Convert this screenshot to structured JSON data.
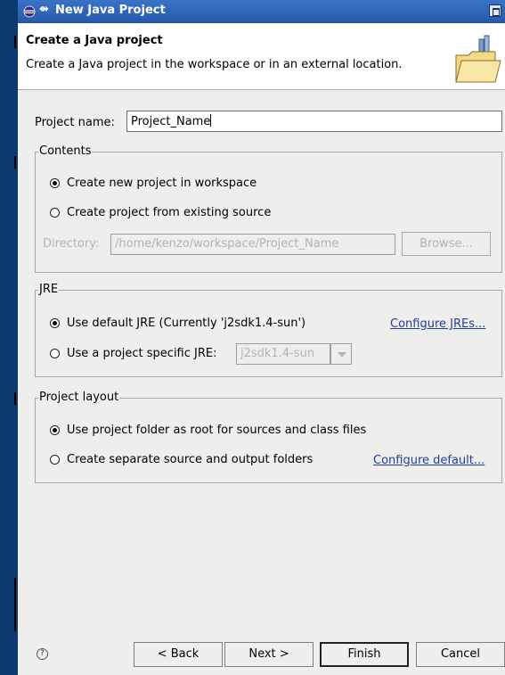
{
  "window": {
    "title": "New Java Project"
  },
  "header": {
    "title": "Create a Java project",
    "description": "Create a Java project in the workspace or in an external location."
  },
  "project_name": {
    "label": "Project name:",
    "value": "Project_Name"
  },
  "contents": {
    "legend": "Contents",
    "options": [
      {
        "label": "Create new project in workspace",
        "checked": true
      },
      {
        "label": "Create project from existing source",
        "checked": false
      }
    ],
    "directory_label": "Directory:",
    "directory_value": "/home/kenzo/workspace/Project_Name",
    "browse_label": "Browse..."
  },
  "jre": {
    "legend": "JRE",
    "options": [
      {
        "label": "Use default JRE (Currently 'j2sdk1.4-sun')",
        "checked": true
      },
      {
        "label": "Use a project specific JRE:",
        "checked": false
      }
    ],
    "configure_link": "Configure JREs...",
    "combo_value": "j2sdk1.4-sun"
  },
  "layout": {
    "legend": "Project layout",
    "options": [
      {
        "label": "Use project folder as root for sources and class files",
        "checked": true
      },
      {
        "label": "Create separate source and output folders",
        "checked": false
      }
    ],
    "configure_link": "Configure default..."
  },
  "footer": {
    "help_symbol": "?",
    "back_label": "< Back",
    "next_label": "Next >",
    "finish_label": "Finish",
    "cancel_label": "Cancel"
  }
}
